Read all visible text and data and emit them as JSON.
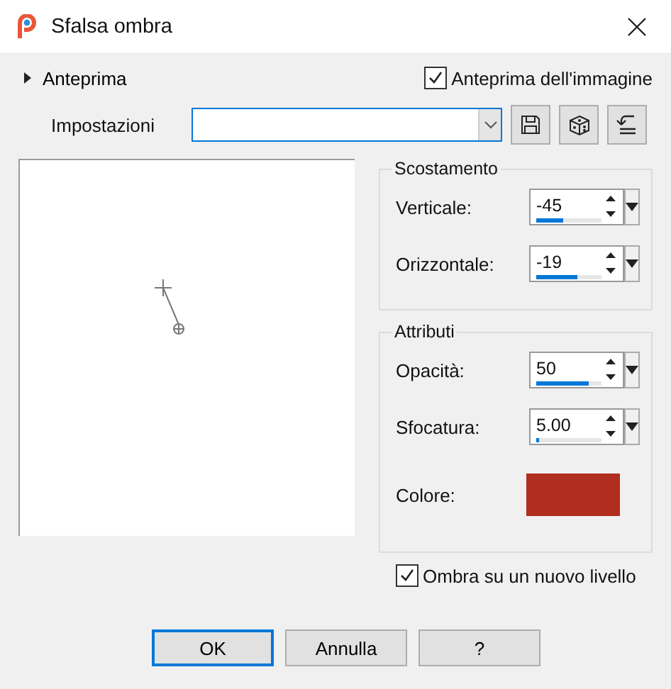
{
  "window": {
    "title": "Sfalsa ombra"
  },
  "preview_toggle": {
    "label": "Anteprima",
    "expanded": false
  },
  "image_preview": {
    "label": "Anteprima dell'immagine",
    "checked": true
  },
  "presets": {
    "label": "Impostazioni"
  },
  "offset_group": {
    "title": "Scostamento",
    "fields": [
      {
        "label": "Verticale:",
        "value": "-45",
        "level": 0.42
      },
      {
        "label": "Orizzontale:",
        "value": "-19",
        "level": 0.64
      }
    ]
  },
  "attributes_group": {
    "title": "Attributi",
    "fields": [
      {
        "label": "Opacità:",
        "value": "50",
        "level": 0.8
      },
      {
        "label": "Sfocatura:",
        "value": "5.00",
        "level": 0.05
      }
    ],
    "color_field": {
      "label": "Colore:",
      "color": "#b02e1e"
    }
  },
  "new_layer": {
    "label": "Ombra su un nuovo livello",
    "checked": true
  },
  "buttons": [
    {
      "label": "OK",
      "default": true
    },
    {
      "label": "Annulla",
      "default": false
    },
    {
      "label": "?",
      "default": false
    }
  ]
}
